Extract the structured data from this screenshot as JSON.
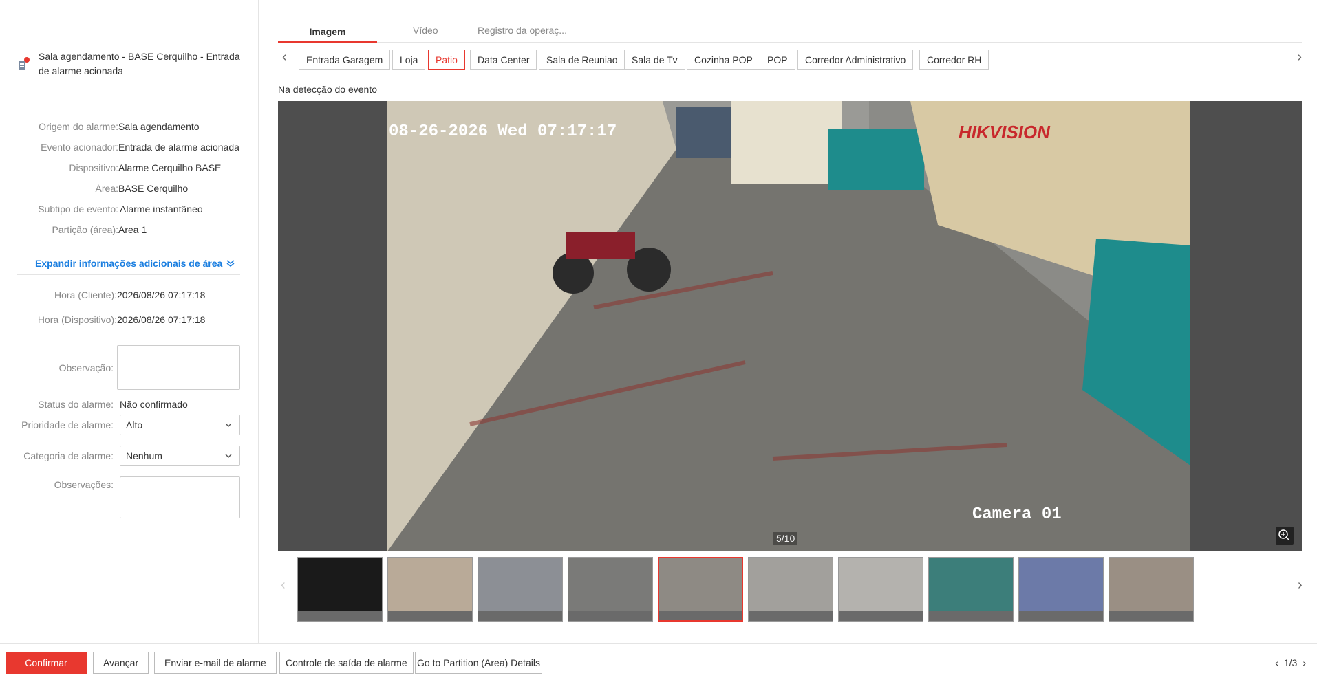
{
  "alarm": {
    "title_line1": "Sala agendamento - BASE Cerquilho - Entrada",
    "title_line2": "de alarme acionada"
  },
  "details": [
    {
      "label": "Origem do alarme:",
      "value": "Sala agendamento"
    },
    {
      "label": "Evento acionador:",
      "value": "Entrada de alarme acionada"
    },
    {
      "label": "Dispositivo:",
      "value": "Alarme Cerquilho BASE"
    },
    {
      "label": "Área:",
      "value": "BASE Cerquilho"
    },
    {
      "label": "Subtipo de evento:",
      "value": "Alarme instantâneo"
    },
    {
      "label": "Partição (área):",
      "value": "Area 1"
    }
  ],
  "expand_label": "Expandir informações adicionais de área",
  "times": [
    {
      "label": "Hora (Cliente):",
      "value": "2026/08/26 07:17:18"
    },
    {
      "label": "Hora (Dispositivo):",
      "value": "2026/08/26 07:17:18"
    }
  ],
  "form": {
    "observacao_label": "Observação:",
    "status_label": "Status do alarme:",
    "status_value": "Não confirmado",
    "priority_label": "Prioridade de alarme:",
    "priority_value": "Alto",
    "category_label": "Categoria de alarme:",
    "category_value": "Nenhum",
    "observacoes_label": "Observações:"
  },
  "tabs": [
    "Imagem",
    "Vídeo",
    "Registro da operaç..."
  ],
  "cameras": [
    "Entrada Garagem",
    "Loja",
    "Patio",
    "Data Center",
    "Sala de Reuniao",
    "Sala de Tv",
    "Cozinha POP",
    "POP",
    "Corredor Administrativo",
    "Corredor RH"
  ],
  "active_camera": "Patio",
  "event_label": "Na detecção do evento",
  "image": {
    "timestamp": "08-26-2026 Wed 07:17:17",
    "brand": "HIKVISION",
    "camera_name": "Camera 01",
    "counter": "5/10"
  },
  "buttons": {
    "confirm": "Confirmar",
    "advance": "Avançar",
    "email": "Enviar e-mail de alarme",
    "output": "Controle de saída de alarme",
    "partition": "Go to Partition (Area) Details"
  },
  "pager": "1/3",
  "colors": {
    "accent": "#e8382f",
    "link": "#1a7ee0"
  }
}
